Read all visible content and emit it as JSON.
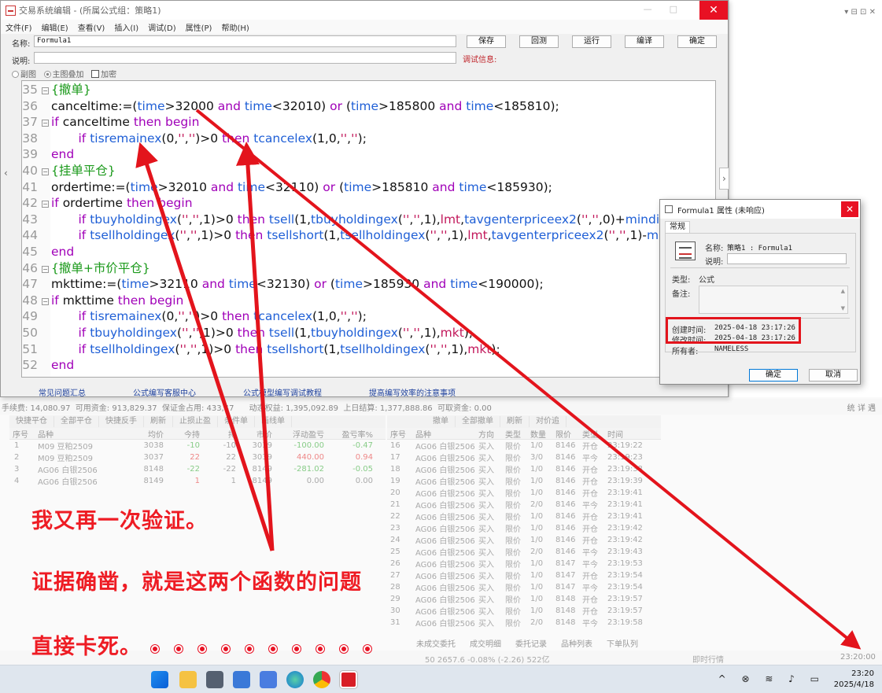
{
  "editor": {
    "title": "交易系统编辑 - (所属公式组：策略1)",
    "menu": [
      "文件(F)",
      "编辑(E)",
      "查看(V)",
      "插入(I)",
      "调试(D)",
      "属性(P)",
      "帮助(H)"
    ],
    "name_label": "名称:",
    "name_value": "Formula1",
    "desc_label": "说明:",
    "buttons": [
      "保存",
      "回测",
      "运行",
      "编译",
      "确定"
    ],
    "debug_info_label": "调试信息:",
    "options": [
      "副图",
      "主图叠加",
      "加密"
    ],
    "bottom_links": [
      "常见问题汇总",
      "公式编写客服中心",
      "公式模型编写调试教程",
      "提高编写效率的注意事项"
    ]
  },
  "code": {
    "line_numbers": [
      "35",
      "36",
      "37",
      "38",
      "39",
      "40",
      "41",
      "42",
      "43",
      "44",
      "45",
      "46",
      "47",
      "48",
      "49",
      "50",
      "51",
      "52"
    ]
  },
  "prop_dialog": {
    "title": "Formula1 属性 (未响应)",
    "tab": "常规",
    "name_label": "名称:",
    "name_value": "策略1 : Formula1",
    "desc_label": "说明:",
    "type_label": "类型:",
    "type_value": "公式",
    "note_label": "备注:",
    "created_label": "创建时间:",
    "created_value": "2025-04-18 23:17:26",
    "modified_label": "修改时间:",
    "modified_value": "2025-04-18 23:17:26",
    "owner_label": "所有者:",
    "owner_value": "NAMELESS",
    "ok": "确定",
    "cancel": "取消"
  },
  "account_bar": {
    "fee": "手续费: 14,080.97",
    "available": "可用资金: 913,829.37",
    "margin": "保证金占用: 433,47",
    "dyn_equity": "动态权益: 1,395,092.89",
    "prev_equity": "上日结算: 1,377,888.86",
    "withdrawable": "可取资金: 0.00",
    "tools": "统  详  遇"
  },
  "position_panel": {
    "toolbar": [
      "快捷平仓",
      "全部平仓",
      "快捷反手",
      "刷新",
      "止损止盈",
      "条件单",
      "画线单"
    ],
    "headers": [
      "序号",
      "品种",
      "均价",
      "今持",
      "持",
      "市价",
      "浮动盈亏",
      "盈亏率%"
    ],
    "rows": [
      [
        "1",
        "M09 豆粕2509",
        "3038",
        "-10",
        "-10",
        "3039",
        "-100.00",
        "-0.47"
      ],
      [
        "2",
        "M09 豆粕2509",
        "3037",
        "22",
        "22",
        "3039",
        "440.00",
        "0.94"
      ],
      [
        "3",
        "AG06 白银2506",
        "8148",
        "-22",
        "-22",
        "8149",
        "-281.02",
        "-0.05"
      ],
      [
        "4",
        "AG06 白银2506",
        "8149",
        "1",
        "1",
        "8149",
        "0.00",
        "0.00"
      ]
    ]
  },
  "order_panel": {
    "toolbar": [
      "撤单",
      "全部撤单",
      "刷新",
      "对价追"
    ],
    "headers": [
      "序号",
      "品种",
      "方向",
      "类型",
      "数量",
      "限价",
      "类型",
      "时间"
    ],
    "rows": [
      [
        "16",
        "AG06 白银2506",
        "买入",
        "限价",
        "1/0",
        "8146",
        "开仓",
        "23:19:22"
      ],
      [
        "17",
        "AG06 白银2506",
        "买入",
        "限价",
        "3/0",
        "8146",
        "平今",
        "23:19:23"
      ],
      [
        "18",
        "AG06 白银2506",
        "买入",
        "限价",
        "1/0",
        "8146",
        "开仓",
        "23:19:38"
      ],
      [
        "19",
        "AG06 白银2506",
        "买入",
        "限价",
        "1/0",
        "8146",
        "开仓",
        "23:19:39"
      ],
      [
        "20",
        "AG06 白银2506",
        "买入",
        "限价",
        "1/0",
        "8146",
        "开仓",
        "23:19:41"
      ],
      [
        "21",
        "AG06 白银2506",
        "买入",
        "限价",
        "2/0",
        "8146",
        "平今",
        "23:19:41"
      ],
      [
        "22",
        "AG06 白银2506",
        "买入",
        "限价",
        "1/0",
        "8146",
        "开仓",
        "23:19:41"
      ],
      [
        "23",
        "AG06 白银2506",
        "买入",
        "限价",
        "1/0",
        "8146",
        "开仓",
        "23:19:42"
      ],
      [
        "24",
        "AG06 白银2506",
        "买入",
        "限价",
        "1/0",
        "8146",
        "开仓",
        "23:19:42"
      ],
      [
        "25",
        "AG06 白银2506",
        "买入",
        "限价",
        "2/0",
        "8146",
        "平今",
        "23:19:43"
      ],
      [
        "26",
        "AG06 白银2506",
        "买入",
        "限价",
        "1/0",
        "8147",
        "平今",
        "23:19:53"
      ],
      [
        "27",
        "AG06 白银2506",
        "买入",
        "限价",
        "1/0",
        "8147",
        "开仓",
        "23:19:54"
      ],
      [
        "28",
        "AG06 白银2506",
        "买入",
        "限价",
        "1/0",
        "8147",
        "平今",
        "23:19:54"
      ],
      [
        "29",
        "AG06 白银2506",
        "买入",
        "限价",
        "1/0",
        "8148",
        "开仓",
        "23:19:57"
      ],
      [
        "30",
        "AG06 白银2506",
        "买入",
        "限价",
        "1/0",
        "8148",
        "开仓",
        "23:19:57"
      ],
      [
        "31",
        "AG06 白银2506",
        "买入",
        "限价",
        "2/0",
        "8148",
        "平今",
        "23:19:58"
      ]
    ]
  },
  "bottom_tabs": [
    "未成交委托",
    "成交明细",
    "委托记录",
    "品种列表",
    "下单队列"
  ],
  "status_bar": {
    "quote": "50 2657.6 -0.08% (-2.26) 522亿",
    "realtime": "即时行情",
    "time": "23:20:00"
  },
  "annotations": {
    "line1": "我又再一次验证。",
    "line2": "证据确凿，就是这两个函数的问题",
    "line3": "直接卡死。",
    "dots": 10,
    "colors": {
      "arrow": "#e3141c"
    }
  },
  "taskbar": {
    "time": "23:20",
    "date": "2025/4/18"
  }
}
